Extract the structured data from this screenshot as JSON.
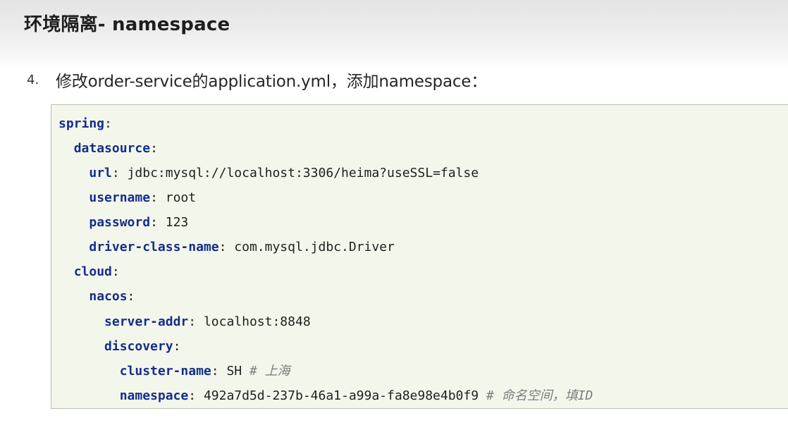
{
  "slide": {
    "title": "环境隔离- namespace",
    "step_number": "4.",
    "step_text": "修改order-service的application.yml，添加namespace："
  },
  "code": {
    "lines": [
      {
        "indent": "",
        "key": "spring",
        "sep": ":",
        "value": "",
        "comment": ""
      },
      {
        "indent": "  ",
        "key": "datasource",
        "sep": ":",
        "value": "",
        "comment": ""
      },
      {
        "indent": "    ",
        "key": "url",
        "sep": ": ",
        "value": "jdbc:mysql://localhost:3306/heima?useSSL=false",
        "comment": ""
      },
      {
        "indent": "    ",
        "key": "username",
        "sep": ": ",
        "value": "root",
        "comment": ""
      },
      {
        "indent": "    ",
        "key": "password",
        "sep": ": ",
        "value": "123",
        "comment": ""
      },
      {
        "indent": "    ",
        "key": "driver-class-name",
        "sep": ": ",
        "value": "com.mysql.jdbc.Driver",
        "comment": ""
      },
      {
        "indent": "  ",
        "key": "cloud",
        "sep": ":",
        "value": "",
        "comment": ""
      },
      {
        "indent": "    ",
        "key": "nacos",
        "sep": ":",
        "value": "",
        "comment": ""
      },
      {
        "indent": "      ",
        "key": "server-addr",
        "sep": ": ",
        "value": "localhost:8848",
        "comment": ""
      },
      {
        "indent": "      ",
        "key": "discovery",
        "sep": ":",
        "value": "",
        "comment": ""
      },
      {
        "indent": "        ",
        "key": "cluster-name",
        "sep": ": ",
        "value": "SH ",
        "comment": "# 上海"
      },
      {
        "indent": "        ",
        "key": "namespace",
        "sep": ": ",
        "value": "492a7d5d-237b-46a1-a99a-fa8e98e4b0f9 ",
        "comment": "# 命名空间，填ID"
      }
    ]
  },
  "colors": {
    "yaml_key": "#142e8c",
    "comment": "#7d7d7d",
    "code_background": "#f3f6eb",
    "code_border": "#b9bdb0"
  }
}
